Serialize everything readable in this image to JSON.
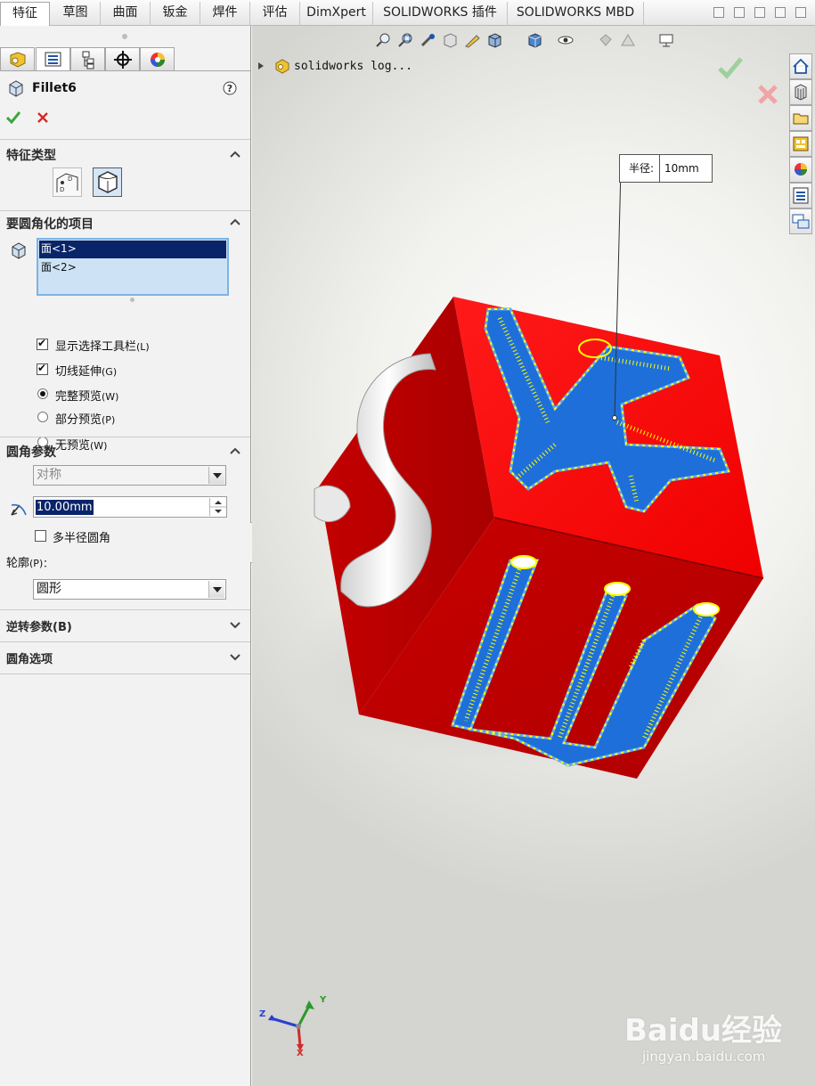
{
  "tabs": [
    "特征",
    "草图",
    "曲面",
    "钣金",
    "焊件",
    "评估",
    "DimXpert",
    "SOLIDWORKS 插件",
    "SOLIDWORKS MBD"
  ],
  "feature": {
    "title": "Fillet6"
  },
  "sections": {
    "feature_type": "特征类型",
    "items_to_fillet": "要圆角化的项目",
    "fillet_params": "圆角参数",
    "setback_params": "逆转参数(B)",
    "fillet_options": "圆角选项"
  },
  "items_list": [
    "面<1>",
    "面<2>"
  ],
  "options": {
    "show_selection_toolbar": {
      "label": "显示选择工具栏",
      "key": "(L)",
      "checked": true
    },
    "tangent_propagation": {
      "label": "切线延伸",
      "key": "(G)",
      "checked": true
    },
    "full_preview": {
      "label": "完整预览",
      "key": "(W)",
      "selected": true
    },
    "partial_preview": {
      "label": "部分预览",
      "key": "(P)",
      "selected": false
    },
    "no_preview": {
      "label": "无预览",
      "key": "(W)",
      "selected": false
    }
  },
  "params": {
    "method": "对称",
    "radius": "10.00mm",
    "multi_radius": {
      "label": "多半径圆角",
      "checked": false
    },
    "profile_label": "轮廓",
    "profile_key": "(P)：",
    "profile_value": "圆形"
  },
  "viewport": {
    "tree_label": "solidworks log...",
    "callout_label": "半径:",
    "callout_value": "10mm",
    "axis_labels": {
      "x": "X",
      "y": "Y",
      "z": "Z"
    },
    "watermark_text": "Baidu经验",
    "watermark_url": "jingyan.baidu.com"
  },
  "colors": {
    "accept": "#3aa63a",
    "cancel": "#d12a2a",
    "cube_red": "#ff0000",
    "face_blue": "#1e6fd9",
    "highlight_yellow": "#ffff00",
    "selection": "#0a246a"
  }
}
